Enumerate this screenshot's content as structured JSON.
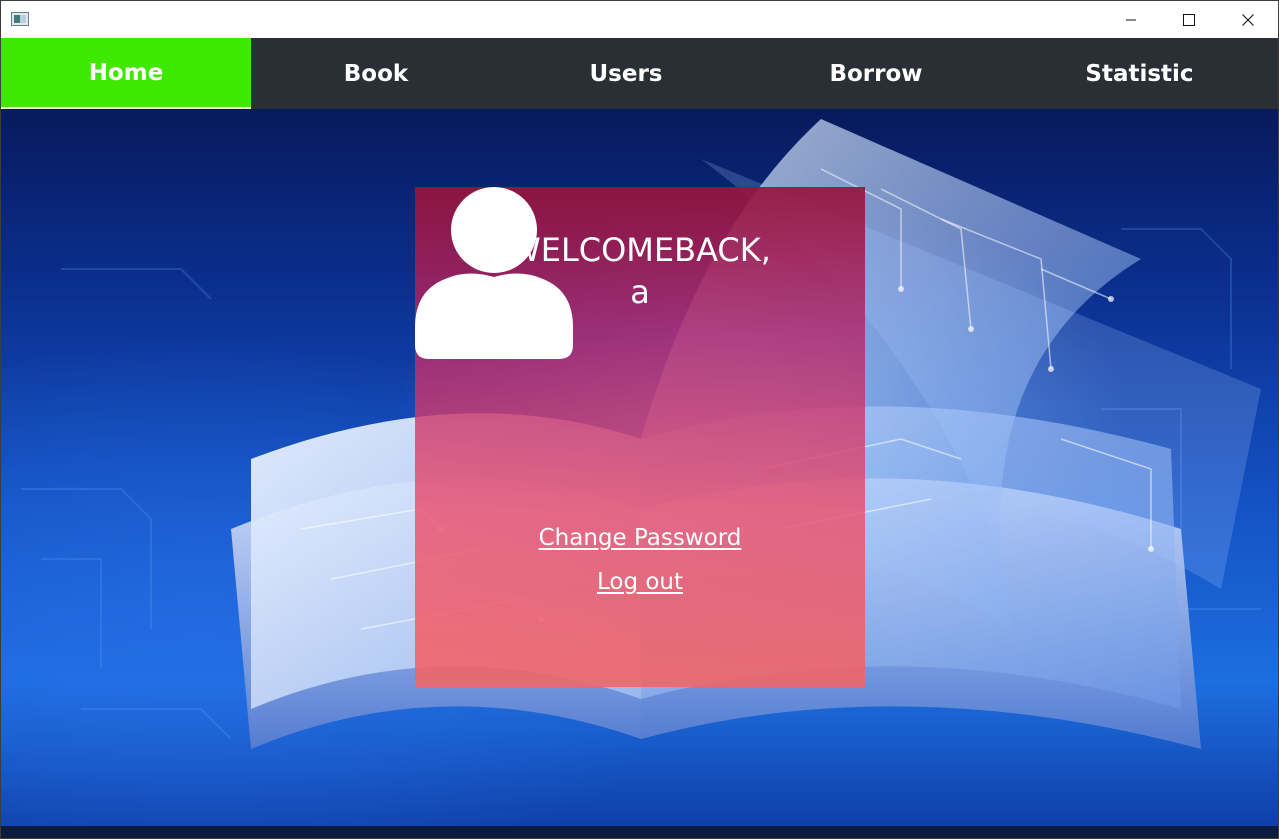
{
  "window": {
    "controls": {
      "minimize_icon": "minimize-icon",
      "maximize_icon": "maximize-icon",
      "close_icon": "close-icon"
    }
  },
  "nav": {
    "tabs": [
      {
        "label": "Home",
        "active": true
      },
      {
        "label": "Book",
        "active": false
      },
      {
        "label": "Users",
        "active": false
      },
      {
        "label": "Borrow",
        "active": false
      },
      {
        "label": "Statistic",
        "active": false
      }
    ],
    "active_color": "#3ee800",
    "bar_color": "#2a2e35"
  },
  "card": {
    "welcome": "WELCOMEBACK,",
    "username": "a",
    "avatar_icon": "user-avatar-icon",
    "change_password": "Change Password",
    "logout": "Log out"
  }
}
